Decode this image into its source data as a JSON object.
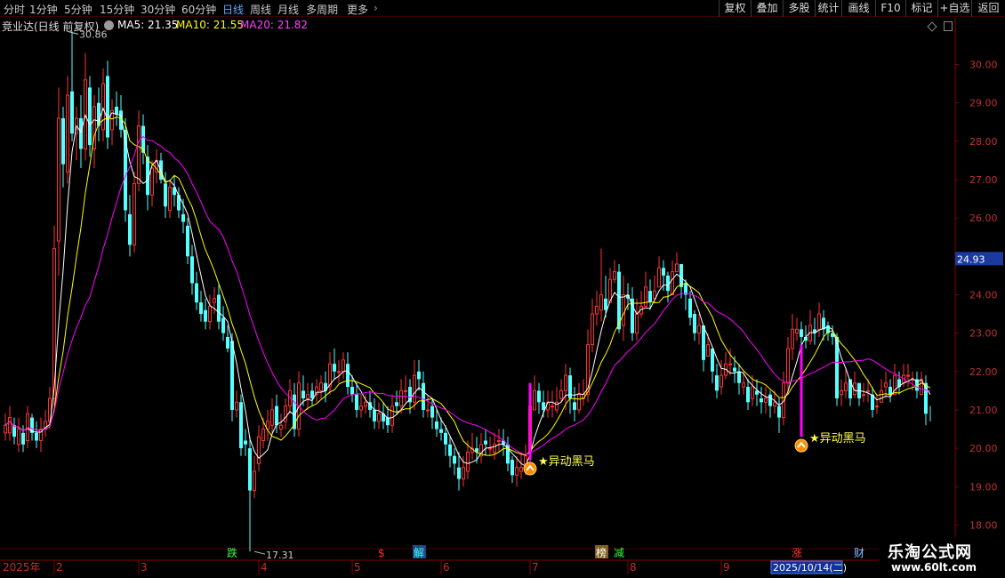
{
  "toolbar": {
    "timeframes": [
      "分时",
      "1分钟",
      "5分钟",
      "15分钟",
      "30分钟",
      "60分钟",
      "日线",
      "周线",
      "月线",
      "多周期",
      "更多"
    ],
    "active_timeframe": "日线",
    "right_buttons": [
      "复权",
      "叠加",
      "多股",
      "统计",
      "画线",
      "F10",
      "标记",
      "+自选",
      "返回"
    ]
  },
  "info": {
    "stock": "竞业达(日线 前复权)",
    "ma5_label": "MA5: 21.35",
    "ma10_label": "MA10: 21.55",
    "ma20_label": "MA20: 21.82"
  },
  "colors": {
    "up": "#ff3232",
    "down": "#54ffff",
    "ma5": "#ffffff",
    "ma10": "#ffff00",
    "ma20": "#ff00ff",
    "grid": "#5a0000",
    "axis_text": "#c03030",
    "signal": "#ffff50",
    "price_tag_bg": "#1a3aa0"
  },
  "chart_data": {
    "type": "candlestick",
    "title": "竞业达(日线 前复权)",
    "ylim": [
      17.5,
      30.8
    ],
    "y_ticks": [
      "30.00",
      "29.00",
      "28.00",
      "27.00",
      "26.00",
      "25.00",
      "24.00",
      "23.00",
      "22.00",
      "21.00",
      "20.00",
      "19.00",
      "18.00"
    ],
    "y_tick_values": [
      30,
      29,
      28,
      27,
      26,
      25,
      24,
      23,
      22,
      21,
      20,
      19,
      18
    ],
    "current_price": "24.93",
    "current_price_value": 24.93,
    "x_labels": [
      "2025年",
      "2",
      "3",
      "4",
      "5",
      "6",
      "7",
      "8",
      "9",
      "10"
    ],
    "x_label_index": [
      0,
      11,
      30,
      57,
      78,
      98,
      118,
      140,
      161,
      181
    ],
    "date_tag": "2025/10/14(二)",
    "high_label": "30.86",
    "high_value": 30.86,
    "high_index": 14,
    "low_label": "17.31",
    "low_value": 17.31,
    "low_index": 56,
    "events": [
      {
        "label": "跌",
        "index": 51,
        "color": "#30ff30"
      },
      {
        "label": "$",
        "index": 85,
        "color": "#ff3030"
      },
      {
        "label": "解",
        "index": 93,
        "color": "#40ffff",
        "bg": "#204a80"
      },
      {
        "label": "榜",
        "index": 134,
        "color": "#ffffff",
        "bg": "#806020"
      },
      {
        "label": "减",
        "index": 138,
        "color": "#30ff30"
      },
      {
        "label": "涨",
        "index": 178,
        "color": "#ff3030"
      },
      {
        "label": "财",
        "index": 192,
        "color": "#80c0ff"
      }
    ],
    "signals": [
      {
        "label": "★异动黑马",
        "index": 118,
        "low": 19.7,
        "high": 21.7
      },
      {
        "label": "★异动黑马",
        "index": 179,
        "low": 20.3,
        "high": 22.7
      }
    ],
    "series": [
      {
        "name": "MA5",
        "key": "ma5"
      },
      {
        "name": "MA10",
        "key": "ma10"
      },
      {
        "name": "MA20",
        "key": "ma20"
      }
    ],
    "close": [
      20.6,
      20.8,
      20.3,
      20.5,
      20.1,
      20.9,
      20.4,
      20.2,
      20.5,
      20.7,
      21.3,
      25.2,
      28.6,
      27.4,
      29.2,
      28.2,
      28.6,
      27.8,
      29.6,
      27.9,
      28.9,
      28.4,
      29.5,
      28.1,
      28.8,
      28.7,
      28.3,
      26.2,
      25.3,
      26.9,
      28.4,
      27.7,
      26.6,
      27.3,
      27.5,
      27.0,
      26.3,
      26.8,
      26.6,
      26.2,
      25.9,
      25.0,
      24.3,
      23.8,
      23.5,
      23.3,
      23.7,
      23.9,
      23.3,
      23.0,
      22.6,
      21.0,
      21.2,
      20.0,
      20.1,
      18.9,
      19.4,
      20.3,
      20.5,
      20.7,
      21.0,
      20.6,
      20.6,
      21.1,
      21.5,
      20.5,
      21.7,
      21.3,
      21.4,
      21.3,
      21.6,
      21.7,
      21.5,
      22.2,
      22.0,
      22.0,
      22.3,
      21.6,
      21.4,
      21.0,
      21.1,
      21.2,
      21.0,
      20.7,
      20.9,
      20.7,
      20.6,
      21.1,
      21.1,
      21.5,
      21.5,
      21.2,
      21.9,
      21.8,
      21.0,
      21.0,
      20.8,
      20.5,
      20.4,
      20.1,
      19.8,
      19.6,
      19.2,
      19.5,
      19.9,
      20.0,
      19.9,
      20.1,
      20.1,
      20.0,
      20.1,
      20.2,
      20.1,
      19.6,
      19.3,
      19.5,
      19.5,
      19.8,
      21.1,
      21.5,
      21.2,
      21.0,
      21.2,
      21.1,
      21.2,
      21.5,
      21.9,
      21.3,
      21.0,
      21.4,
      21.4,
      22.7,
      23.5,
      23.7,
      24.0,
      23.6,
      24.4,
      24.6,
      23.1,
      24.0,
      23.9,
      23.0,
      23.5,
      23.7,
      24.2,
      23.8,
      24.1,
      24.7,
      24.5,
      24.1,
      24.6,
      24.8,
      24.2,
      24.0,
      23.4,
      23.0,
      23.2,
      22.3,
      22.7,
      22.0,
      21.5,
      21.9,
      22.2,
      22.2,
      22.0,
      21.7,
      21.7,
      21.2,
      21.6,
      21.4,
      21.2,
      21.3,
      21.1,
      21.2,
      20.8,
      21.7,
      22.6,
      23.1,
      23.1,
      22.9,
      22.8,
      23.2,
      23.0,
      23.5,
      23.1,
      23.0,
      22.9,
      21.3,
      21.5,
      21.7,
      21.3,
      21.7,
      21.3,
      21.4,
      21.5,
      21.0,
      21.1,
      21.5,
      21.7,
      21.4,
      21.9,
      21.6,
      21.9,
      21.9,
      21.8,
      21.5,
      21.8,
      20.9,
      21.0
    ],
    "open": [
      20.4,
      20.4,
      20.6,
      20.1,
      20.4,
      20.2,
      20.8,
      20.4,
      20.2,
      20.5,
      20.7,
      21.3,
      25.4,
      28.6,
      27.2,
      29.3,
      28.2,
      28.6,
      27.8,
      29.4,
      27.8,
      29.0,
      28.3,
      29.7,
      28.3,
      28.9,
      28.8,
      28.3,
      26.1,
      25.3,
      26.9,
      28.4,
      27.6,
      26.6,
      27.2,
      27.5,
      26.9,
      26.2,
      26.8,
      26.6,
      26.1,
      25.8,
      25.0,
      24.3,
      23.8,
      23.6,
      23.3,
      23.8,
      24.0,
      23.4,
      22.9,
      22.8,
      21.0,
      21.2,
      20.2,
      20.0,
      18.9,
      19.6,
      20.2,
      20.5,
      20.6,
      21.1,
      20.5,
      20.7,
      21.1,
      21.4,
      20.5,
      21.5,
      21.3,
      21.5,
      21.4,
      21.5,
      21.7,
      21.6,
      22.2,
      22.0,
      22.0,
      22.2,
      21.6,
      21.4,
      21.0,
      21.1,
      21.2,
      21.0,
      20.7,
      20.9,
      20.8,
      20.6,
      21.2,
      21.1,
      21.5,
      21.6,
      21.2,
      22.0,
      21.7,
      21.0,
      21.1,
      20.7,
      20.5,
      20.4,
      20.1,
      19.8,
      19.5,
      19.2,
      19.4,
      19.9,
      20.0,
      19.8,
      20.2,
      20.0,
      19.9,
      20.2,
      20.2,
      20.1,
      19.7,
      19.3,
      19.4,
      19.6,
      19.9,
      21.0,
      21.5,
      21.2,
      21.0,
      21.1,
      21.0,
      21.3,
      21.5,
      21.9,
      21.2,
      21.0,
      21.3,
      21.4,
      22.7,
      23.5,
      23.6,
      23.9,
      23.8,
      24.4,
      24.6,
      23.2,
      24.0,
      23.9,
      23.0,
      23.5,
      23.7,
      24.1,
      23.9,
      24.2,
      24.7,
      24.5,
      24.0,
      24.6,
      24.8,
      24.3,
      23.9,
      23.5,
      23.0,
      23.2,
      22.4,
      22.6,
      21.9,
      21.6,
      21.9,
      22.2,
      22.1,
      22.0,
      21.6,
      21.6,
      21.3,
      21.5,
      21.3,
      21.2,
      21.4,
      21.1,
      21.1,
      20.8,
      21.7,
      22.6,
      23.0,
      23.1,
      22.9,
      22.8,
      23.1,
      23.1,
      23.4,
      23.2,
      23.0,
      22.9,
      21.4,
      21.5,
      21.8,
      21.4,
      21.7,
      21.4,
      21.5,
      21.4,
      21.1,
      21.2,
      21.6,
      21.6,
      21.4,
      21.8,
      21.7,
      21.9,
      21.8,
      21.8,
      21.4,
      21.7
    ],
    "high": [
      20.9,
      21.1,
      20.8,
      20.8,
      20.6,
      21.1,
      20.9,
      20.7,
      20.8,
      21.0,
      21.6,
      25.8,
      29.4,
      28.9,
      29.7,
      30.86,
      28.9,
      29.2,
      30.3,
      29.7,
      29.2,
      29.4,
      29.9,
      30.1,
      29.1,
      29.3,
      29.2,
      28.6,
      26.6,
      27.2,
      28.8,
      28.7,
      27.9,
      27.5,
      27.8,
      27.7,
      27.2,
      27.0,
      27.1,
      26.8,
      26.5,
      26.0,
      25.3,
      24.6,
      24.1,
      23.9,
      24.0,
      24.2,
      24.3,
      23.7,
      23.2,
      23.0,
      21.5,
      21.4,
      20.5,
      20.3,
      19.8,
      20.6,
      20.8,
      21.0,
      21.3,
      21.4,
      20.9,
      21.3,
      21.8,
      21.7,
      22.0,
      21.9,
      21.7,
      21.7,
      21.8,
      21.9,
      22.0,
      22.5,
      22.6,
      22.3,
      22.5,
      22.5,
      21.9,
      21.7,
      21.4,
      21.4,
      21.5,
      21.3,
      21.2,
      21.2,
      21.1,
      21.4,
      21.5,
      21.8,
      21.9,
      21.8,
      22.3,
      22.3,
      22.0,
      21.4,
      21.3,
      21.0,
      20.8,
      20.6,
      20.3,
      20.0,
      19.9,
      19.8,
      20.2,
      20.4,
      20.3,
      20.4,
      20.5,
      20.3,
      20.4,
      20.5,
      20.5,
      20.3,
      19.8,
      19.8,
      19.9,
      20.1,
      21.7,
      21.9,
      21.7,
      21.5,
      21.5,
      21.5,
      21.6,
      21.8,
      22.2,
      22.1,
      21.6,
      21.7,
      21.8,
      23.1,
      23.9,
      24.1,
      25.2,
      24.5,
      24.7,
      24.9,
      24.8,
      24.5,
      24.3,
      24.2,
      23.9,
      24.1,
      24.6,
      24.4,
      24.5,
      25.0,
      24.9,
      24.6,
      24.9,
      25.1,
      24.8,
      24.4,
      24.1,
      23.6,
      23.5,
      23.1,
      23.0,
      22.6,
      22.2,
      22.3,
      22.5,
      22.6,
      22.4,
      22.2,
      22.0,
      21.8,
      21.9,
      21.8,
      21.6,
      21.6,
      21.5,
      21.5,
      21.3,
      22.0,
      22.9,
      23.5,
      23.4,
      23.3,
      23.2,
      23.6,
      23.4,
      23.8,
      23.6,
      23.3,
      23.2,
      23.0,
      21.8,
      22.1,
      21.8,
      22.0,
      21.7,
      21.7,
      21.8,
      21.6,
      21.4,
      21.8,
      22.0,
      21.8,
      22.2,
      22.0,
      22.2,
      22.2,
      22.0,
      22.0,
      22.0,
      21.9,
      21.1
    ],
    "low": [
      20.2,
      20.2,
      20.1,
      19.9,
      19.9,
      20.0,
      20.2,
      20.0,
      19.9,
      20.3,
      20.5,
      21.1,
      24.5,
      26.8,
      26.9,
      28.0,
      27.5,
      27.3,
      27.5,
      27.6,
      27.3,
      28.0,
      28.0,
      27.8,
      27.9,
      28.4,
      28.1,
      25.9,
      25.0,
      25.1,
      26.7,
      27.4,
      26.2,
      26.3,
      26.9,
      26.9,
      26.0,
      26.0,
      26.3,
      26.0,
      25.6,
      24.8,
      24.0,
      23.6,
      23.3,
      23.1,
      23.1,
      23.5,
      23.1,
      22.8,
      22.5,
      20.7,
      20.8,
      19.8,
      19.8,
      17.31,
      18.7,
      19.4,
      20.0,
      20.2,
      20.4,
      20.4,
      20.3,
      20.5,
      20.9,
      20.3,
      20.3,
      21.1,
      21.0,
      21.1,
      21.2,
      21.3,
      21.2,
      21.4,
      21.8,
      21.7,
      21.8,
      21.4,
      21.2,
      20.8,
      20.8,
      20.9,
      20.8,
      20.5,
      20.5,
      20.5,
      20.4,
      20.4,
      20.9,
      20.9,
      21.2,
      20.9,
      21.0,
      21.5,
      20.8,
      20.8,
      20.5,
      20.3,
      20.2,
      19.8,
      19.5,
      19.3,
      18.9,
      19.0,
      19.2,
      19.7,
      19.6,
      19.6,
      19.8,
      19.8,
      19.7,
      19.9,
      19.8,
      19.4,
      19.1,
      19.0,
      19.2,
      19.3,
      19.5,
      21.2,
      20.9,
      20.8,
      20.8,
      20.8,
      20.9,
      21.2,
      21.0,
      20.9,
      20.7,
      20.9,
      21.1,
      21.2,
      22.5,
      23.2,
      23.3,
      23.4,
      24.0,
      24.3,
      23.0,
      22.8,
      23.6,
      22.8,
      22.8,
      23.4,
      23.8,
      23.6,
      23.8,
      24.4,
      24.1,
      23.8,
      24.3,
      24.6,
      23.9,
      23.6,
      23.2,
      22.8,
      22.7,
      22.0,
      22.4,
      21.7,
      21.3,
      21.4,
      21.8,
      21.9,
      21.7,
      21.4,
      21.4,
      21.0,
      21.1,
      21.1,
      20.9,
      20.9,
      20.8,
      20.9,
      20.4,
      20.6,
      21.5,
      22.3,
      22.8,
      22.7,
      22.6,
      22.7,
      22.7,
      22.9,
      22.8,
      22.8,
      22.7,
      21.1,
      21.1,
      21.3,
      21.1,
      21.3,
      21.1,
      21.2,
      21.2,
      20.8,
      20.9,
      21.2,
      21.3,
      21.2,
      21.5,
      21.4,
      21.6,
      21.6,
      21.5,
      21.3,
      21.4,
      20.6,
      20.7
    ]
  }
}
